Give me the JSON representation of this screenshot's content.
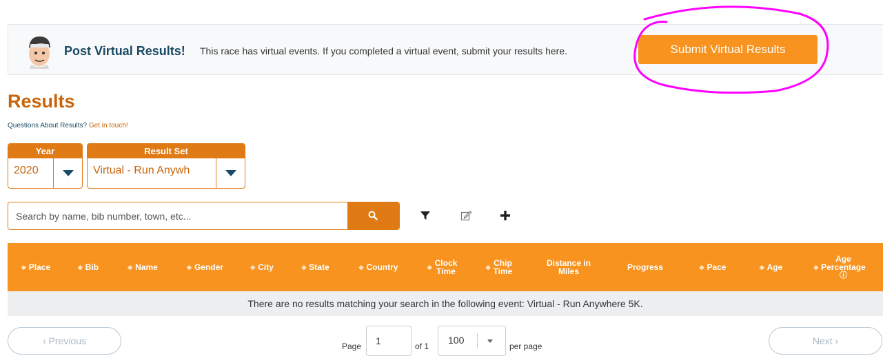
{
  "banner": {
    "title": "Post Virtual Results!",
    "text": "This race has virtual events. If you completed a virtual event, submit your results here.",
    "button_label": "Submit Virtual Results",
    "highlight_color": "#ff00ff"
  },
  "results": {
    "heading": "Results",
    "questions_text": "Questions About Results?",
    "questions_link": "Get in touch!"
  },
  "filters": {
    "year": {
      "label": "Year",
      "value": "2020"
    },
    "result_set": {
      "label": "Result Set",
      "value": "Virtual - Run Anywh"
    }
  },
  "search": {
    "placeholder": "Search by name, bib number, town, etc..."
  },
  "toolbar": {
    "icons": [
      "filter-icon",
      "edit-icon",
      "plus-icon"
    ]
  },
  "table": {
    "columns": [
      {
        "line1": "Place",
        "line2": "",
        "sort": true
      },
      {
        "line1": "Bib",
        "line2": "",
        "sort": true
      },
      {
        "line1": "Name",
        "line2": "",
        "sort": true
      },
      {
        "line1": "Gender",
        "line2": "",
        "sort": true
      },
      {
        "line1": "City",
        "line2": "",
        "sort": true
      },
      {
        "line1": "State",
        "line2": "",
        "sort": true
      },
      {
        "line1": "Country",
        "line2": "",
        "sort": true
      },
      {
        "line1": "Clock",
        "line2": "Time",
        "sort": true
      },
      {
        "line1": "Chip",
        "line2": "Time",
        "sort": true
      },
      {
        "line1": "Distance in",
        "line2": "Miles",
        "sort": false
      },
      {
        "line1": "Progress",
        "line2": "",
        "sort": false
      },
      {
        "line1": "Pace",
        "line2": "",
        "sort": true
      },
      {
        "line1": "Age",
        "line2": "",
        "sort": true
      },
      {
        "line1": "Age",
        "line2": "Percentage",
        "sort": true
      }
    ],
    "empty_message": "There are no results matching your search in the following event: Virtual - Run Anywhere 5K."
  },
  "pagination": {
    "previous_label": "‹ Previous",
    "next_label": "Next ›",
    "page_label": "Page",
    "page_value": "1",
    "of_label": "of 1",
    "per_page_value": "100",
    "per_page_label": "per page"
  },
  "colors": {
    "accent": "#f7931e",
    "accent_dark": "#e07a14",
    "heading": "#c8640a",
    "navy": "#1a4a64"
  }
}
